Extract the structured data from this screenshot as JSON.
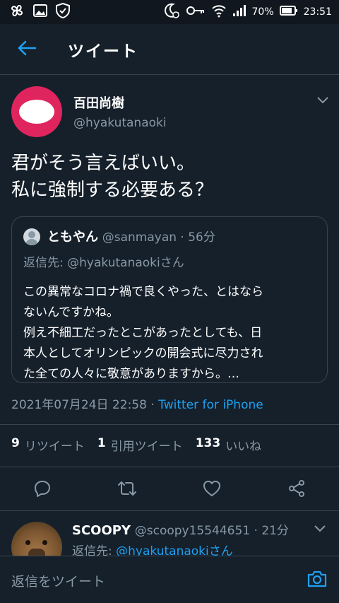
{
  "status_bar": {
    "battery_percent": "70%",
    "time": "23:51",
    "left_icons": [
      "pinwheel-icon",
      "gallery-icon",
      "shield-icon"
    ],
    "right_icons": [
      "moon-alarm-icon",
      "key-icon",
      "wifi-icon",
      "signal-icon",
      "battery-icon"
    ]
  },
  "header": {
    "title": "ツイート",
    "back_icon": "arrow-left-icon",
    "accent": "#1da1f2"
  },
  "tweet": {
    "author_name": "百田尚樹",
    "author_handle": "@hyakutanaoki",
    "text_line1": "君がそう言えばいい。",
    "text_line2": "私に強制する必要ある？",
    "timestamp": "2021年07月24日 22:58",
    "separator": " · ",
    "source": "Twitter for iPhone",
    "retweets_count": "9",
    "retweets_label": "リツイート",
    "quotes_count": "1",
    "quotes_label": "引用ツイート",
    "likes_count": "133",
    "likes_label": "いいね",
    "avatar_color": "#e0245e"
  },
  "quoted_tweet": {
    "name": "ともやん",
    "handle": "@sanmayan",
    "dot": " · ",
    "time": "56分",
    "reply_to": "返信先: @hyakutanaokiさん",
    "line1": "この異常なコロナ禍で良くやった、とはなら",
    "line2": "ないんですかね。",
    "line3": "例え不細工だったとこがあったとしても、日",
    "line4": "本人としてオリンピックの開会式に尽力され",
    "line5": "た全ての人々に敬意がありますから。…"
  },
  "actions": [
    "comment-icon",
    "retweet-icon",
    "like-icon",
    "share-icon"
  ],
  "reply_preview": {
    "name": "SCOOPY",
    "handle": "@scoopy15544651",
    "dot": " · ",
    "time": "21分",
    "reply_prefix": "返信先: ",
    "reply_mention": "@hyakutanaokiさん"
  },
  "composer": {
    "placeholder": "返信をツイート",
    "camera_icon": "camera-icon"
  },
  "colors": {
    "background": "#15202b",
    "border": "#38444d",
    "secondary_text": "#8899a6",
    "link": "#1da1f2"
  }
}
